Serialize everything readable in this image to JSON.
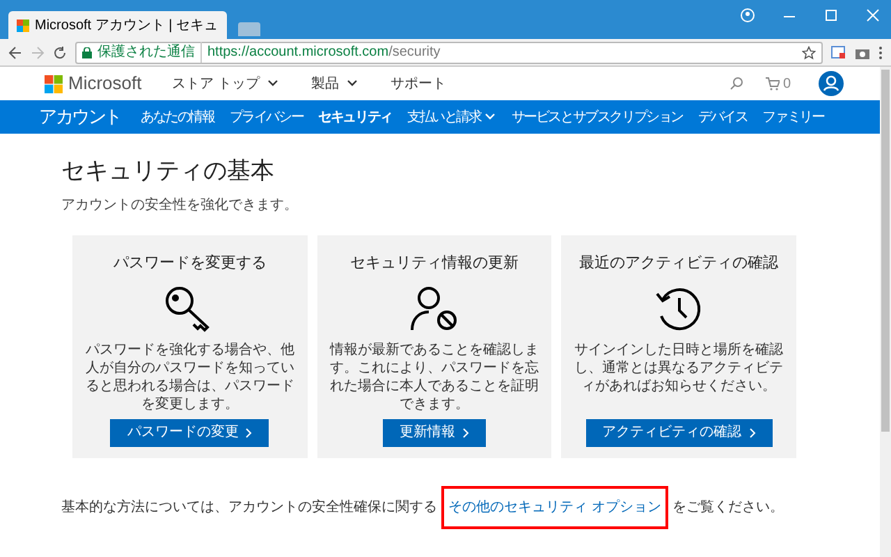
{
  "browser": {
    "tabs": [
      {
        "label": "Microsoft アカウント | セキュ",
        "selected": true
      },
      {
        "selected": false
      }
    ],
    "secure_label": "保護された通信",
    "url_host": "https://account.microsoft.com",
    "url_path": "/security"
  },
  "header": {
    "brand": "Microsoft",
    "menu": [
      {
        "label": "ストア トップ",
        "dropdown": true
      },
      {
        "label": "製品",
        "dropdown": true
      },
      {
        "label": "サポート",
        "dropdown": false
      }
    ],
    "cart_count": "0"
  },
  "nav": {
    "title": "アカウント",
    "items": [
      {
        "label": "あなたの情報",
        "selected": false,
        "dropdown": false
      },
      {
        "label": "プライバシー",
        "selected": false,
        "dropdown": false
      },
      {
        "label": "セキュリティ",
        "selected": true,
        "dropdown": false
      },
      {
        "label": "支払いと請求",
        "selected": false,
        "dropdown": true
      },
      {
        "label": "サービスとサブスクリプション",
        "selected": false,
        "dropdown": false
      },
      {
        "label": "デバイス",
        "selected": false,
        "dropdown": false
      },
      {
        "label": "ファミリー",
        "selected": false,
        "dropdown": false
      }
    ]
  },
  "page": {
    "title": "セキュリティの基本",
    "subtitle": "アカウントの安全性を強化できます。"
  },
  "cards": [
    {
      "kind": "key",
      "title": "パスワードを変更する",
      "body": "パスワードを強化する場合や、他人が自分のパスワードを知っていると思われる場合は、パスワードを変更します。",
      "button": "パスワードの変更"
    },
    {
      "kind": "person",
      "title": "セキュリティ情報の更新",
      "body": "情報が最新であることを確認します。これにより、パスワードを忘れた場合に本人であることを証明できます。",
      "button": "更新情報"
    },
    {
      "kind": "history",
      "title": "最近のアクティビティの確認",
      "body": "サインインした日時と場所を確認し、通常とは異なるアクティビティがあればお知らせください。",
      "button": "アクティビティの確認"
    }
  ],
  "footer": {
    "before": "基本的な方法については、アカウントの安全性確保に関する",
    "link": "その他のセキュリティ オプション",
    "after": "をご覧ください。",
    "highlighted": true
  }
}
